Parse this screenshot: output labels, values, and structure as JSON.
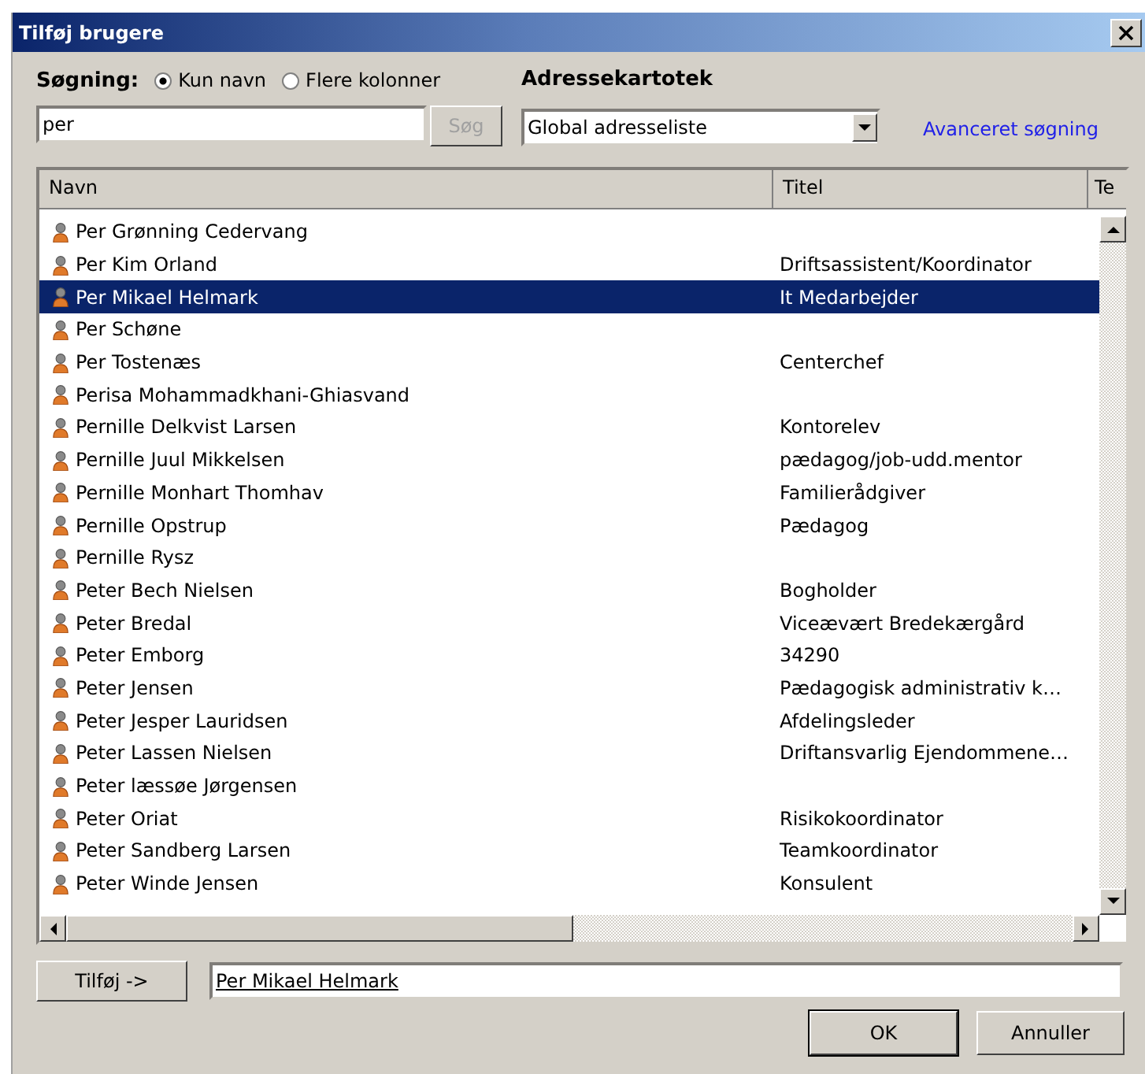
{
  "window": {
    "title": "Tilføj brugere"
  },
  "search": {
    "label": "Søgning:",
    "options": [
      {
        "label": "Kun navn",
        "selected": true
      },
      {
        "label": "Flere kolonner",
        "selected": false
      }
    ],
    "value": "per",
    "button": {
      "label": "Søg",
      "disabled": true
    }
  },
  "address_book": {
    "label": "Adressekartotek",
    "value": "Global adresseliste",
    "advanced_link": "Avanceret søgning"
  },
  "table": {
    "columns": [
      "Navn",
      "Titel",
      "Te"
    ],
    "rows": [
      {
        "name": "Per Grønning Cedervang",
        "title": "",
        "selected": false
      },
      {
        "name": "Per Kim Orland",
        "title": "Driftsassistent/Koordinator",
        "selected": false
      },
      {
        "name": "Per Mikael Helmark",
        "title": "It Medarbejder",
        "selected": true
      },
      {
        "name": "Per Schøne",
        "title": "",
        "selected": false
      },
      {
        "name": "Per Tostenæs",
        "title": "Centerchef",
        "selected": false
      },
      {
        "name": "Perisa Mohammadkhani-Ghiasvand",
        "title": "",
        "selected": false
      },
      {
        "name": "Pernille Delkvist Larsen",
        "title": "Kontorelev",
        "selected": false
      },
      {
        "name": "Pernille Juul Mikkelsen",
        "title": "pædagog/job-udd.mentor",
        "selected": false
      },
      {
        "name": "Pernille Monhart Thomhav",
        "title": "Familierådgiver",
        "selected": false
      },
      {
        "name": "Pernille Opstrup",
        "title": "Pædagog",
        "selected": false
      },
      {
        "name": "Pernille Rysz",
        "title": "",
        "selected": false
      },
      {
        "name": "Peter Bech Nielsen",
        "title": "Bogholder",
        "selected": false
      },
      {
        "name": "Peter Bredal",
        "title": "Viceævært Bredekærgård",
        "selected": false
      },
      {
        "name": "Peter Emborg",
        "title": "34290",
        "selected": false
      },
      {
        "name": "Peter Jensen",
        "title": "Pædagogisk administrativ k…",
        "selected": false
      },
      {
        "name": "Peter Jesper Lauridsen",
        "title": "Afdelingsleder",
        "selected": false
      },
      {
        "name": "Peter Lassen Nielsen",
        "title": "Driftansvarlig Ejendommene…",
        "selected": false
      },
      {
        "name": "Peter læssøe Jørgensen",
        "title": "",
        "selected": false
      },
      {
        "name": "Peter Oriat",
        "title": "Risikokoordinator",
        "selected": false
      },
      {
        "name": "Peter Sandberg Larsen",
        "title": "Teamkoordinator",
        "selected": false
      },
      {
        "name": "Peter Winde Jensen",
        "title": "Konsulent",
        "selected": false
      }
    ]
  },
  "add": {
    "button": "Tilføj ->",
    "value": "Per Mikael Helmark"
  },
  "buttons": [
    "OK",
    "Annuller"
  ]
}
